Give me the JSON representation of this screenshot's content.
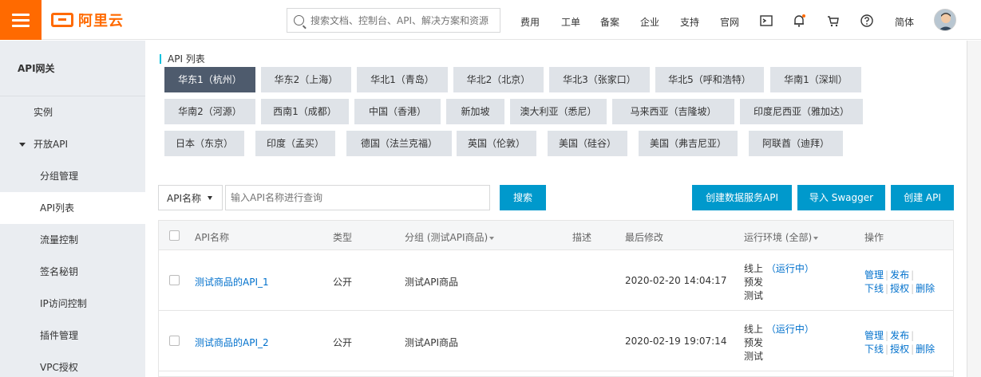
{
  "header": {
    "logo_text": "阿里云",
    "search_placeholder": "搜索文档、控制台、API、解决方案和资源",
    "nav": [
      "费用",
      "工单",
      "备案",
      "企业",
      "支持",
      "官网"
    ],
    "lang": "简体"
  },
  "sidebar": {
    "title": "API网关",
    "items": {
      "instance": "实例",
      "open_api": "开放API",
      "group_mgmt": "分组管理",
      "api_list": "API列表",
      "flow_control": "流量控制",
      "sign_key": "签名秘钥",
      "ip_control": "IP访问控制",
      "plugin_mgmt": "插件管理",
      "vpc_auth": "VPC授权"
    }
  },
  "main": {
    "title": "API 列表",
    "regions": [
      "华东1（杭州）",
      "华东2（上海）",
      "华北1（青岛）",
      "华北2（北京）",
      "华北3（张家口）",
      "华北5（呼和浩特）",
      "华南1（深圳）",
      "华南2（河源）",
      "西南1（成都）",
      "中国（香港）",
      "新加坡",
      "澳大利亚（悉尼）",
      "马来西亚（吉隆坡）",
      "印度尼西亚（雅加达）",
      "日本（东京）",
      "印度（孟买）",
      "德国（法兰克福）",
      "英国（伦敦）",
      "美国（硅谷）",
      "美国（弗吉尼亚）",
      "阿联酋（迪拜）"
    ],
    "filter_select": "API名称",
    "query_placeholder": "输入API名称进行查询",
    "search_button": "搜索",
    "create_data_api": "创建数据服务API",
    "import_swagger": "导入 Swagger",
    "create_api": "创建 API",
    "columns": {
      "name": "API名称",
      "type": "类型",
      "group": "分组 (测试API商品)",
      "desc": "描述",
      "modified": "最后修改",
      "env": "运行环境 (全部)",
      "ops": "操作"
    },
    "rows": [
      {
        "name": "测试商品的API_1",
        "type": "公开",
        "group": "测试API商品",
        "modified": "2020-02-20 14:04:17",
        "env_online": "线上",
        "env_running": "（运行中）",
        "env_pre": "预发",
        "env_test": "测试",
        "op_manage": "管理",
        "op_publish": "发布",
        "op_offline": "下线",
        "op_auth": "授权",
        "op_delete": "删除"
      },
      {
        "name": "测试商品的API_2",
        "type": "公开",
        "group": "测试API商品",
        "modified": "2020-02-19 19:07:14",
        "env_online": "线上",
        "env_running": "（运行中）",
        "env_pre": "预发",
        "env_test": "测试",
        "op_manage": "管理",
        "op_publish": "发布",
        "op_offline": "下线",
        "op_auth": "授权",
        "op_delete": "删除"
      }
    ]
  },
  "colors": {
    "brand": "#ff6a00",
    "primary_button": "#0099cc",
    "active_region": "#4e5b6d",
    "link": "#0070cc"
  }
}
